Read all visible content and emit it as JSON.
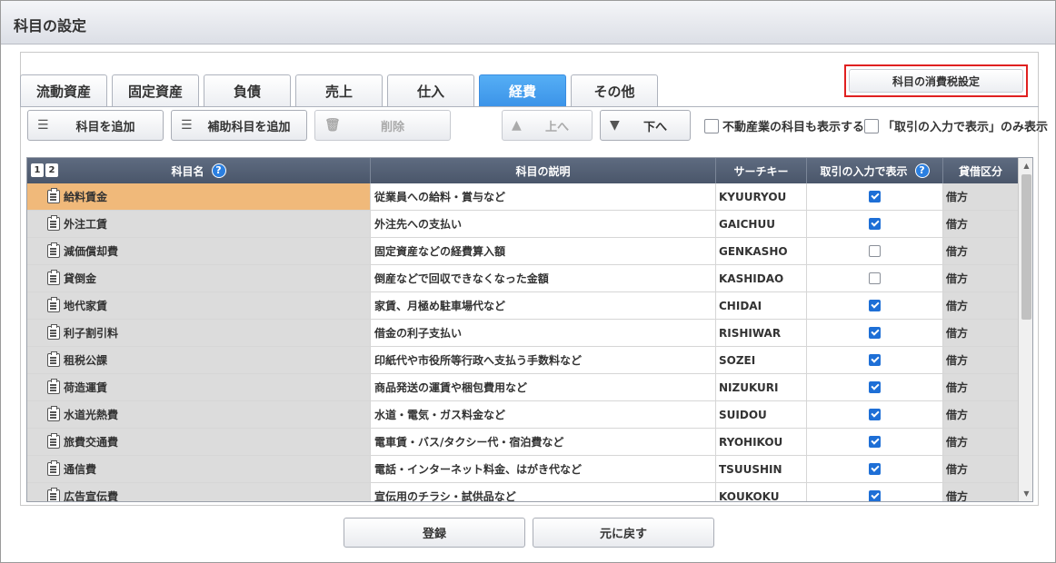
{
  "window": {
    "title": "科目の設定"
  },
  "tabs": [
    {
      "label": "流動資産",
      "active": false
    },
    {
      "label": "固定資産",
      "active": false
    },
    {
      "label": "負債",
      "active": false
    },
    {
      "label": "売上",
      "active": false
    },
    {
      "label": "仕入",
      "active": false
    },
    {
      "label": "経費",
      "active": true
    },
    {
      "label": "その他",
      "active": false
    }
  ],
  "tax_settings_label": "科目の消費税設定",
  "toolbar": {
    "add_account": "科目を追加",
    "add_sub_account": "補助科目を追加",
    "delete": "削除",
    "move_up": "上へ",
    "move_down": "下へ",
    "show_real_estate": "不動産業の科目も表示する",
    "show_input_only": "「取引の入力で表示」のみ表示"
  },
  "grid": {
    "pages": [
      "1",
      "2"
    ],
    "columns": [
      "科目名",
      "科目の説明",
      "サーチキー",
      "取引の入力で表示",
      "貸借区分"
    ],
    "rows": [
      {
        "name": "給料賃金",
        "desc": "従業員への給料・賞与など",
        "key": "KYUURYOU",
        "show": true,
        "side": "借方",
        "selected": true
      },
      {
        "name": "外注工賃",
        "desc": "外注先への支払い",
        "key": "GAICHUU",
        "show": true,
        "side": "借方"
      },
      {
        "name": "減価償却費",
        "desc": "固定資産などの経費算入額",
        "key": "GENKASHO",
        "show": false,
        "side": "借方"
      },
      {
        "name": "貸倒金",
        "desc": "倒産などで回収できなくなった金額",
        "key": "KASHIDAO",
        "show": false,
        "side": "借方"
      },
      {
        "name": "地代家賃",
        "desc": "家賃、月極め駐車場代など",
        "key": "CHIDAI",
        "show": true,
        "side": "借方"
      },
      {
        "name": "利子割引料",
        "desc": "借金の利子支払い",
        "key": "RISHIWAR",
        "show": true,
        "side": "借方"
      },
      {
        "name": "租税公課",
        "desc": "印紙代や市役所等行政へ支払う手数料など",
        "key": "SOZEI",
        "show": true,
        "side": "借方"
      },
      {
        "name": "荷造運賃",
        "desc": "商品発送の運賃や梱包費用など",
        "key": "NIZUKURI",
        "show": true,
        "side": "借方"
      },
      {
        "name": "水道光熱費",
        "desc": "水道・電気・ガス料金など",
        "key": "SUIDOU",
        "show": true,
        "side": "借方"
      },
      {
        "name": "旅費交通費",
        "desc": "電車賃・バス/タクシー代・宿泊費など",
        "key": "RYOHIKOU",
        "show": true,
        "side": "借方"
      },
      {
        "name": "通信費",
        "desc": "電話・インターネット料金、はがき代など",
        "key": "TSUUSHIN",
        "show": true,
        "side": "借方"
      },
      {
        "name": "広告宣伝費",
        "desc": "宣伝用のチラシ・試供品など",
        "key": "KOUKOKU",
        "show": true,
        "side": "借方"
      }
    ]
  },
  "footer": {
    "register": "登録",
    "revert": "元に戻す"
  }
}
